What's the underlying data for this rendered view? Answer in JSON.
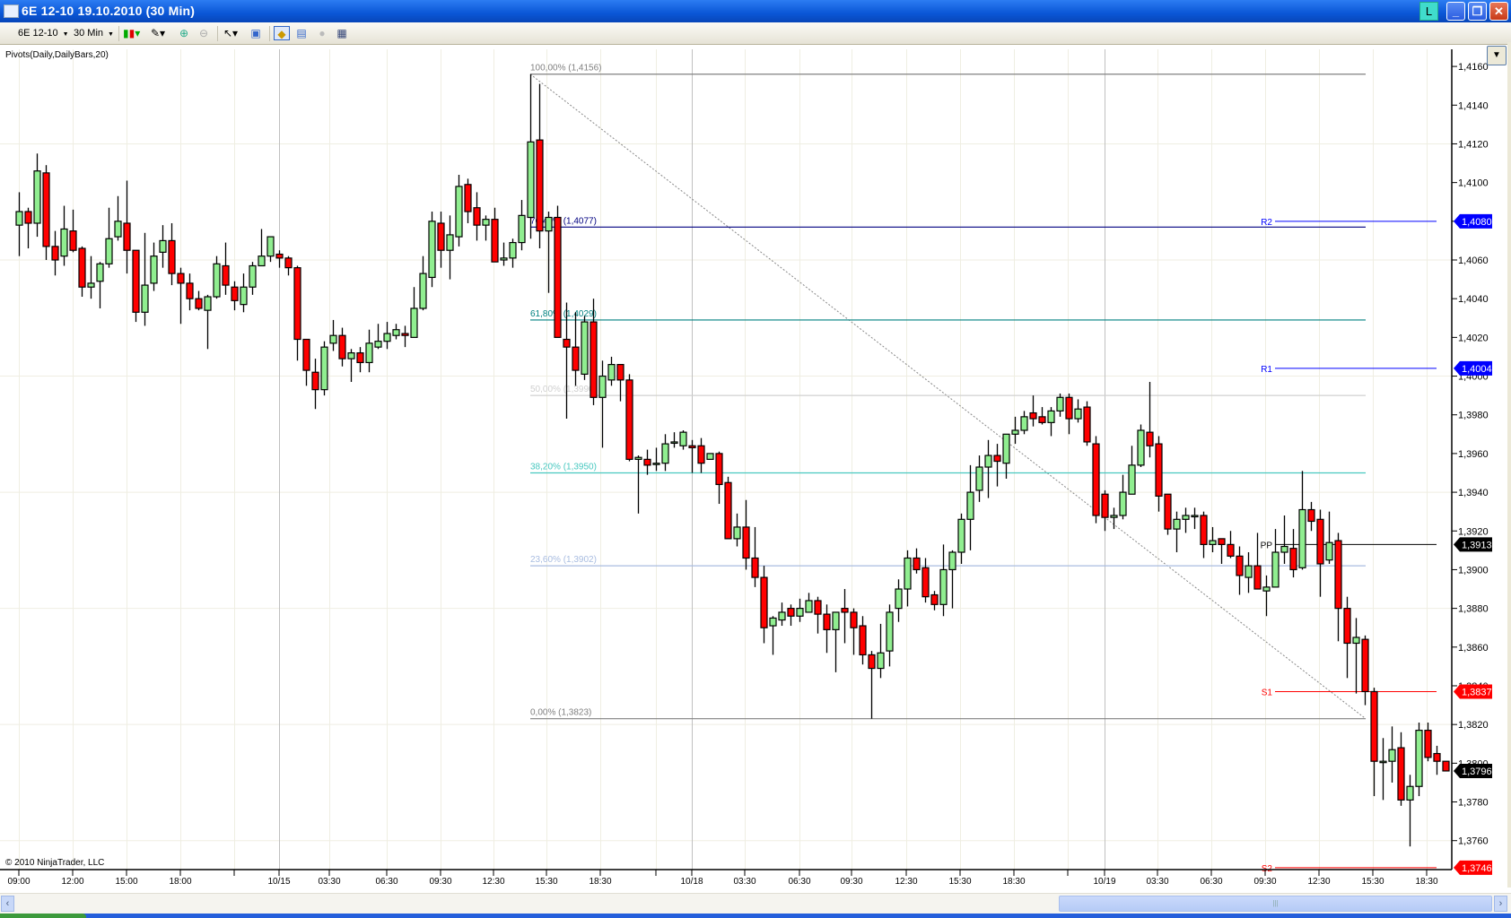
{
  "window": {
    "title": "6E 12-10  19.10.2010 (30 Min)",
    "badge_label": "L"
  },
  "toolbar": {
    "instrument": "6E 12-10",
    "interval": "30 Min"
  },
  "indicator_label": "Pivots(Daily,DailyBars,20)",
  "copyright": "© 2010 NinjaTrader, LLC",
  "colors": {
    "up": "#90ee90",
    "down": "#ff0000",
    "pivot_r": "#0000ff",
    "pivot_s": "#ff0000",
    "pivot_pp": "#000000",
    "grid": "#efeee2",
    "day_sep": "#c0c0c0"
  },
  "chart_data": {
    "type": "candlestick",
    "instrument": "6E 12-10",
    "interval": "30 Min",
    "ylim": [
      1.374,
      1.4168
    ],
    "y_ticks": [
      "1,4160",
      "1,4140",
      "1,4120",
      "1,4100",
      "1,4080",
      "1,4060",
      "1,4040",
      "1,4020",
      "1,4000",
      "1,3980",
      "1,3960",
      "1,3940",
      "1,3920",
      "1,3900",
      "1,3880",
      "1,3860",
      "1,3840",
      "1,3820",
      "1,3800",
      "1,3780",
      "1,3760"
    ],
    "y_tick_values": [
      1.416,
      1.414,
      1.412,
      1.41,
      1.408,
      1.406,
      1.404,
      1.402,
      1.4,
      1.398,
      1.396,
      1.394,
      1.392,
      1.39,
      1.388,
      1.386,
      1.384,
      1.382,
      1.38,
      1.378,
      1.376
    ],
    "h_grid": [
      1.412,
      1.406,
      1.4,
      1.394,
      1.388,
      1.382,
      1.376
    ],
    "x_labels": [
      {
        "bar": 0,
        "text": "09:00"
      },
      {
        "bar": 6,
        "text": "12:00"
      },
      {
        "bar": 12,
        "text": "15:00"
      },
      {
        "bar": 18,
        "text": "18:00"
      },
      {
        "bar": 24,
        "text": ""
      },
      {
        "bar": 29,
        "text": "10/15",
        "day": true
      },
      {
        "bar": 34.6,
        "text": "03:30"
      },
      {
        "bar": 41,
        "text": "06:30"
      },
      {
        "bar": 47,
        "text": "09:30"
      },
      {
        "bar": 52.9,
        "text": "12:30"
      },
      {
        "bar": 58.8,
        "text": "15:30"
      },
      {
        "bar": 64.8,
        "text": "18:30"
      },
      {
        "bar": 71,
        "text": ""
      },
      {
        "bar": 75,
        "text": "10/18",
        "day": true
      },
      {
        "bar": 80.9,
        "text": "03:30"
      },
      {
        "bar": 87,
        "text": "06:30"
      },
      {
        "bar": 92.8,
        "text": "09:30"
      },
      {
        "bar": 98.9,
        "text": "12:30"
      },
      {
        "bar": 104.9,
        "text": "15:30"
      },
      {
        "bar": 110.9,
        "text": "18:30"
      },
      {
        "bar": 116.9,
        "text": ""
      },
      {
        "bar": 121,
        "text": "10/19",
        "day": true
      },
      {
        "bar": 126.9,
        "text": "03:30"
      },
      {
        "bar": 132.9,
        "text": "06:30"
      },
      {
        "bar": 138.9,
        "text": "09:30"
      },
      {
        "bar": 144.9,
        "text": "12:30"
      },
      {
        "bar": 150.9,
        "text": "15:30"
      },
      {
        "bar": 156.9,
        "text": "18:30"
      }
    ],
    "candles_ohlc": [
      [
        1.4078,
        1.4095,
        1.4062,
        1.4085
      ],
      [
        1.4085,
        1.4087,
        1.4066,
        1.4079
      ],
      [
        1.4079,
        1.4115,
        1.4072,
        1.4106
      ],
      [
        1.4105,
        1.4109,
        1.406,
        1.4067
      ],
      [
        1.4067,
        1.4075,
        1.4052,
        1.406
      ],
      [
        1.4062,
        1.4088,
        1.4057,
        1.4076
      ],
      [
        1.4075,
        1.4086,
        1.4064,
        1.4065
      ],
      [
        1.4066,
        1.4067,
        1.4041,
        1.4046
      ],
      [
        1.4046,
        1.4062,
        1.404,
        1.4048
      ],
      [
        1.4049,
        1.4059,
        1.4035,
        1.4058
      ],
      [
        1.4058,
        1.4087,
        1.4056,
        1.4071
      ],
      [
        1.4072,
        1.4093,
        1.407,
        1.408
      ],
      [
        1.4079,
        1.4101,
        1.4053,
        1.4065
      ],
      [
        1.4065,
        1.4065,
        1.4028,
        1.4033
      ],
      [
        1.4033,
        1.4074,
        1.4026,
        1.4047
      ],
      [
        1.4048,
        1.4069,
        1.4044,
        1.4062
      ],
      [
        1.4064,
        1.4078,
        1.4056,
        1.407
      ],
      [
        1.407,
        1.4079,
        1.4047,
        1.4053
      ],
      [
        1.4053,
        1.4056,
        1.4027,
        1.4048
      ],
      [
        1.4048,
        1.4053,
        1.4034,
        1.404
      ],
      [
        1.404,
        1.4044,
        1.4034,
        1.4035
      ],
      [
        1.4034,
        1.4042,
        1.4014,
        1.4041
      ],
      [
        1.4041,
        1.4062,
        1.404,
        1.4058
      ],
      [
        1.4057,
        1.4069,
        1.4042,
        1.4047
      ],
      [
        1.4046,
        1.4049,
        1.4034,
        1.4039
      ],
      [
        1.4037,
        1.4053,
        1.4033,
        1.4046
      ],
      [
        1.4046,
        1.4059,
        1.4042,
        1.4057
      ],
      [
        1.4057,
        1.4076,
        1.4057,
        1.4062
      ],
      [
        1.4062,
        1.4072,
        1.4059,
        1.4072
      ],
      [
        1.4063,
        1.4065,
        1.4056,
        1.4061
      ],
      [
        1.4061,
        1.4062,
        1.4052,
        1.4056
      ],
      [
        1.4056,
        1.4057,
        1.4008,
        1.4019
      ],
      [
        1.4019,
        1.4019,
        1.3995,
        1.4003
      ],
      [
        1.4002,
        1.4009,
        1.3983,
        1.3993
      ],
      [
        1.3993,
        1.4018,
        1.399,
        1.4015
      ],
      [
        1.4017,
        1.4029,
        1.4013,
        1.4021
      ],
      [
        1.4021,
        1.4025,
        1.4005,
        1.4009
      ],
      [
        1.4009,
        1.4014,
        1.3997,
        1.4012
      ],
      [
        1.4012,
        1.4015,
        1.4002,
        1.4007
      ],
      [
        1.4007,
        1.4024,
        1.4002,
        1.4017
      ],
      [
        1.4015,
        1.4027,
        1.4014,
        1.4018
      ],
      [
        1.4018,
        1.4028,
        1.4014,
        1.4022
      ],
      [
        1.4021,
        1.4027,
        1.4019,
        1.4024
      ],
      [
        1.4022,
        1.4026,
        1.4015,
        1.4021
      ],
      [
        1.402,
        1.4046,
        1.402,
        1.4035
      ],
      [
        1.4035,
        1.4062,
        1.4034,
        1.4053
      ],
      [
        1.4051,
        1.4085,
        1.4046,
        1.408
      ],
      [
        1.4079,
        1.4085,
        1.4056,
        1.4065
      ],
      [
        1.4065,
        1.4083,
        1.405,
        1.4073
      ],
      [
        1.4072,
        1.4104,
        1.4067,
        1.4098
      ],
      [
        1.4099,
        1.4102,
        1.4079,
        1.4085
      ],
      [
        1.4087,
        1.4095,
        1.407,
        1.4078
      ],
      [
        1.4078,
        1.4083,
        1.407,
        1.4081
      ],
      [
        1.4081,
        1.4087,
        1.4059,
        1.4059
      ],
      [
        1.406,
        1.4069,
        1.4057,
        1.4061
      ],
      [
        1.4061,
        1.4071,
        1.4056,
        1.4069
      ],
      [
        1.4069,
        1.4091,
        1.4065,
        1.4083
      ],
      [
        1.4082,
        1.4156,
        1.4071,
        1.4121
      ],
      [
        1.4122,
        1.4151,
        1.4066,
        1.4075
      ],
      [
        1.4075,
        1.4085,
        1.4043,
        1.4082
      ],
      [
        1.4082,
        1.4088,
        1.402,
        1.402
      ],
      [
        1.4019,
        1.4038,
        1.3978,
        1.4015
      ],
      [
        1.4015,
        1.4033,
        1.3995,
        1.4003
      ],
      [
        1.4001,
        1.4031,
        1.3998,
        1.4028
      ],
      [
        1.4028,
        1.404,
        1.3985,
        1.3989
      ],
      [
        1.3989,
        1.4008,
        1.3963,
        1.4
      ],
      [
        1.3998,
        1.401,
        1.3995,
        1.4006
      ],
      [
        1.4006,
        1.4006,
        1.3987,
        1.3998
      ],
      [
        1.3998,
        1.4001,
        1.3956,
        1.3957
      ],
      [
        1.3957,
        1.3959,
        1.3929,
        1.3958
      ],
      [
        1.3957,
        1.3962,
        1.3949,
        1.3954
      ],
      [
        1.3955,
        1.3963,
        1.3951,
        1.3955
      ],
      [
        1.3955,
        1.397,
        1.3951,
        1.3965
      ],
      [
        1.3966,
        1.3971,
        1.3963,
        1.3966
      ],
      [
        1.3964,
        1.3972,
        1.3962,
        1.3971
      ],
      [
        1.3964,
        1.3967,
        1.395,
        1.3963
      ],
      [
        1.3964,
        1.3968,
        1.395,
        1.3955
      ],
      [
        1.3957,
        1.396,
        1.3957,
        1.396
      ],
      [
        1.396,
        1.3961,
        1.3934,
        1.3944
      ],
      [
        1.3945,
        1.3948,
        1.3916,
        1.3916
      ],
      [
        1.3916,
        1.3929,
        1.3912,
        1.3922
      ],
      [
        1.3922,
        1.3936,
        1.39,
        1.3906
      ],
      [
        1.3906,
        1.3922,
        1.3891,
        1.3896
      ],
      [
        1.3896,
        1.3902,
        1.3862,
        1.387
      ],
      [
        1.3871,
        1.3876,
        1.3856,
        1.3875
      ],
      [
        1.3874,
        1.3883,
        1.3871,
        1.3878
      ],
      [
        1.388,
        1.3882,
        1.3871,
        1.3876
      ],
      [
        1.3876,
        1.3885,
        1.3873,
        1.388
      ],
      [
        1.3878,
        1.3888,
        1.3878,
        1.3884
      ],
      [
        1.3884,
        1.3886,
        1.3867,
        1.3877
      ],
      [
        1.3877,
        1.3882,
        1.3857,
        1.3869
      ],
      [
        1.3869,
        1.3878,
        1.3847,
        1.3878
      ],
      [
        1.388,
        1.389,
        1.3862,
        1.3878
      ],
      [
        1.3878,
        1.388,
        1.3856,
        1.387
      ],
      [
        1.3871,
        1.3876,
        1.3851,
        1.3856
      ],
      [
        1.3856,
        1.3858,
        1.3823,
        1.3849
      ],
      [
        1.3849,
        1.3872,
        1.3844,
        1.3857
      ],
      [
        1.3858,
        1.3882,
        1.385,
        1.3878
      ],
      [
        1.388,
        1.3895,
        1.3873,
        1.389
      ],
      [
        1.389,
        1.391,
        1.3881,
        1.3906
      ],
      [
        1.3906,
        1.3911,
        1.3898,
        1.39
      ],
      [
        1.3901,
        1.3906,
        1.3883,
        1.3886
      ],
      [
        1.3887,
        1.3889,
        1.3879,
        1.3882
      ],
      [
        1.3882,
        1.3913,
        1.3876,
        1.39
      ],
      [
        1.39,
        1.391,
        1.388,
        1.3909
      ],
      [
        1.3909,
        1.3929,
        1.3903,
        1.3926
      ],
      [
        1.3926,
        1.3954,
        1.391,
        1.394
      ],
      [
        1.3941,
        1.3959,
        1.3935,
        1.3953
      ],
      [
        1.3953,
        1.3967,
        1.3937,
        1.3959
      ],
      [
        1.3959,
        1.3965,
        1.3943,
        1.3956
      ],
      [
        1.3955,
        1.397,
        1.3947,
        1.397
      ],
      [
        1.397,
        1.3979,
        1.3965,
        1.3972
      ],
      [
        1.3972,
        1.3982,
        1.397,
        1.3979
      ],
      [
        1.3981,
        1.399,
        1.3974,
        1.3978
      ],
      [
        1.3979,
        1.3984,
        1.3975,
        1.3976
      ],
      [
        1.3976,
        1.3984,
        1.3969,
        1.3982
      ],
      [
        1.3982,
        1.3991,
        1.3979,
        1.3989
      ],
      [
        1.3989,
        1.3991,
        1.397,
        1.3978
      ],
      [
        1.3978,
        1.3988,
        1.3976,
        1.3983
      ],
      [
        1.3984,
        1.3987,
        1.3964,
        1.3966
      ],
      [
        1.3965,
        1.3969,
        1.3924,
        1.3928
      ],
      [
        1.3939,
        1.3941,
        1.392,
        1.3927
      ],
      [
        1.3927,
        1.3932,
        1.3921,
        1.3928
      ],
      [
        1.3928,
        1.3949,
        1.3926,
        1.394
      ],
      [
        1.3939,
        1.3964,
        1.3939,
        1.3954
      ],
      [
        1.3954,
        1.3975,
        1.3953,
        1.3972
      ],
      [
        1.3971,
        1.3997,
        1.3958,
        1.3964
      ],
      [
        1.3965,
        1.3969,
        1.393,
        1.3938
      ],
      [
        1.3939,
        1.3939,
        1.3918,
        1.3921
      ],
      [
        1.3921,
        1.393,
        1.3909,
        1.3926
      ],
      [
        1.3926,
        1.3932,
        1.3919,
        1.3928
      ],
      [
        1.3928,
        1.3932,
        1.3921,
        1.3928
      ],
      [
        1.3928,
        1.393,
        1.3906,
        1.3913
      ],
      [
        1.3913,
        1.3922,
        1.3909,
        1.3915
      ],
      [
        1.3916,
        1.3916,
        1.3903,
        1.3913
      ],
      [
        1.3913,
        1.392,
        1.3906,
        1.3907
      ],
      [
        1.3907,
        1.3912,
        1.3887,
        1.3897
      ],
      [
        1.3896,
        1.3909,
        1.3888,
        1.3902
      ],
      [
        1.3902,
        1.3919,
        1.389,
        1.389
      ],
      [
        1.3889,
        1.3897,
        1.3876,
        1.3891
      ],
      [
        1.3891,
        1.3921,
        1.3891,
        1.3909
      ],
      [
        1.3909,
        1.3928,
        1.3903,
        1.3912
      ],
      [
        1.3911,
        1.3921,
        1.3896,
        1.39
      ],
      [
        1.3901,
        1.3951,
        1.39,
        1.3931
      ],
      [
        1.3931,
        1.3935,
        1.392,
        1.3925
      ],
      [
        1.3926,
        1.3931,
        1.3886,
        1.3903
      ],
      [
        1.3905,
        1.393,
        1.3903,
        1.3914
      ],
      [
        1.3915,
        1.3919,
        1.3863,
        1.388
      ],
      [
        1.388,
        1.3886,
        1.3844,
        1.3862
      ],
      [
        1.3862,
        1.3875,
        1.3836,
        1.3865
      ],
      [
        1.3864,
        1.3866,
        1.383,
        1.3837
      ],
      [
        1.3837,
        1.3839,
        1.3783,
        1.3801
      ],
      [
        1.3801,
        1.3813,
        1.3781,
        1.3801
      ],
      [
        1.3801,
        1.3819,
        1.379,
        1.3807
      ],
      [
        1.3808,
        1.3816,
        1.3778,
        1.3781
      ],
      [
        1.3781,
        1.3794,
        1.3757,
        1.3788
      ],
      [
        1.3788,
        1.3821,
        1.3783,
        1.3817
      ],
      [
        1.3817,
        1.3821,
        1.3801,
        1.3803
      ],
      [
        1.3805,
        1.3809,
        1.3794,
        1.3801
      ],
      [
        1.3801,
        1.3801,
        1.3796,
        1.3796
      ]
    ],
    "last_price": {
      "value": 1.3796,
      "label": "1,3796"
    },
    "fibonacci": {
      "from_bar": 57,
      "to_bar": 150,
      "levels": [
        {
          "label": "100,00% (1,4156)",
          "price": 1.4156,
          "color": "#808080"
        },
        {
          "label": "76,40% (1,4077)",
          "price": 1.4077,
          "color": "#000080"
        },
        {
          "label": "61,80% (1,4029)",
          "price": 1.4029,
          "color": "#008080"
        },
        {
          "label": "50,00% (1,3990)",
          "price": 1.399,
          "color": "#d0d0d0"
        },
        {
          "label": "38,20% (1,3950)",
          "price": 1.395,
          "color": "#48c8c0"
        },
        {
          "label": "23,60% (1,3902)",
          "price": 1.3902,
          "color": "#a8bce0"
        },
        {
          "label": "0,00% (1,3823)",
          "price": 1.3823,
          "color": "#808080"
        }
      ]
    },
    "pivots": [
      {
        "name": "R2",
        "price": 1.408,
        "label": "1,4080",
        "color": "#0000ff"
      },
      {
        "name": "R1",
        "price": 1.4004,
        "label": "1,4004",
        "color": "#0000ff"
      },
      {
        "name": "PP",
        "price": 1.3913,
        "label": "1,3913",
        "color": "#000000"
      },
      {
        "name": "S1",
        "price": 1.3837,
        "label": "1,3837",
        "color": "#ff0000"
      },
      {
        "name": "S2",
        "price": 1.3746,
        "label": "1,3746",
        "color": "#ff0000"
      }
    ]
  }
}
